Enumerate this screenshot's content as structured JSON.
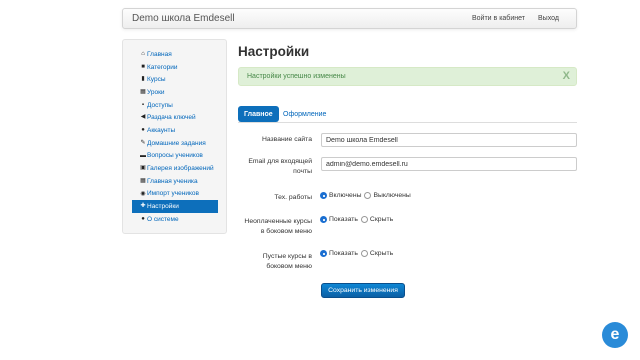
{
  "navbar": {
    "brand": "Demo школа Emdesell",
    "login_label": "Войти в кабинет",
    "logout_label": "Выход"
  },
  "sidebar": {
    "items": [
      {
        "label": "Главная",
        "icon": "home-icon",
        "glyph": "⌂"
      },
      {
        "label": "Категории",
        "icon": "briefcase-icon",
        "glyph": "■"
      },
      {
        "label": "Курсы",
        "icon": "book-icon",
        "glyph": "▮"
      },
      {
        "label": "Уроки",
        "icon": "grid-list-icon",
        "glyph": "▦"
      },
      {
        "label": "Доступы",
        "icon": "lock-icon",
        "glyph": "▪"
      },
      {
        "label": "Раздача ключей",
        "icon": "bullhorn-icon",
        "glyph": "◀"
      },
      {
        "label": "Аккаунты",
        "icon": "user-icon",
        "glyph": "●"
      },
      {
        "label": "Домашние задания",
        "icon": "pencil-icon",
        "glyph": "✎"
      },
      {
        "label": "Вопросы учеников",
        "icon": "comment-icon",
        "glyph": "▬"
      },
      {
        "label": "Галерея изображений",
        "icon": "picture-icon",
        "glyph": "▣"
      },
      {
        "label": "Главная ученика",
        "icon": "th-large-icon",
        "glyph": "▦"
      },
      {
        "label": "Импорт учеников",
        "icon": "import-icon",
        "glyph": "◉"
      },
      {
        "label": "Настройки",
        "icon": "wrench-icon",
        "glyph": "✚",
        "active": true
      },
      {
        "label": "О системе",
        "icon": "info-icon",
        "glyph": "●"
      }
    ]
  },
  "main": {
    "title": "Настройки",
    "alert": {
      "text": "Настройки успешно изменены",
      "close": "X"
    },
    "tabs": [
      {
        "label": "Главное",
        "active": true
      },
      {
        "label": "Оформление",
        "active": false
      }
    ],
    "form": {
      "site_name_label": "Название сайта",
      "site_name_value": "Demo школа Emdesell",
      "email_label": "Email для входящей почты",
      "email_value": "admin@demo.emdesell.ru",
      "maintenance_label": "Тех. работы",
      "maintenance_on": "Включены",
      "maintenance_off": "Выключены",
      "unpaid_label": "Неоплаченные курсы в боковом меню",
      "unpaid_show": "Показать",
      "unpaid_hide": "Скрыть",
      "empty_label": "Пустые курсы в боковом меню",
      "empty_show": "Показать",
      "empty_hide": "Скрыть",
      "save_label": "Сохранить изменения"
    }
  },
  "help": {
    "glyph": "e",
    "icon": "help-chat-icon"
  },
  "colors": {
    "accent": "#0d6fbb",
    "link": "#0066bb",
    "alert_bg": "#dff0d8",
    "alert_text": "#468847",
    "help_button": "#2a8bd8"
  }
}
